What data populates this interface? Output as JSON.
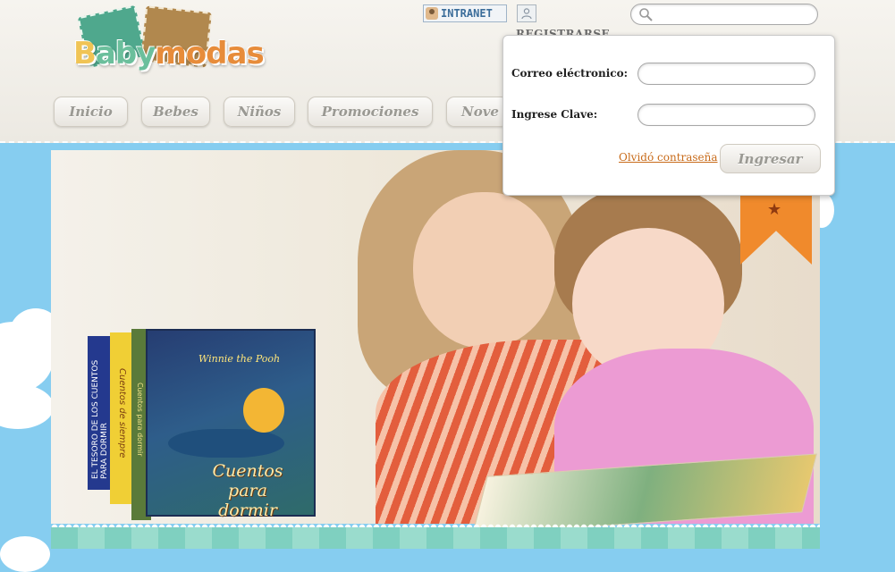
{
  "logo": {
    "text_part1": "B",
    "text_part2": "aby",
    "text_part3": "modas"
  },
  "topbar": {
    "intranet_label": "INTRANET",
    "register_label": "REGISTRARSE",
    "search_placeholder": ""
  },
  "nav": {
    "items": [
      {
        "label": "Inicio"
      },
      {
        "label": "Bebes"
      },
      {
        "label": "Niños"
      },
      {
        "label": "Promociones"
      },
      {
        "label": "Nove"
      }
    ]
  },
  "login": {
    "email_label": "Correo eléctronico:",
    "password_label": "Ingrese Clave:",
    "forgot_label": "Olvidó contraseña",
    "submit_label": "Ingresar",
    "email_value": "",
    "password_value": ""
  },
  "banner": {
    "book_title_line1": "Cuentos",
    "book_title_line2": "para dormir",
    "book_brand": "Winnie the Pooh",
    "spine1": "EL TESORO DE LOS CUENTOS PARA DORMIR",
    "spine2": "Cuentos de siempre",
    "spine3": "Cuentos para dormir"
  },
  "colors": {
    "sky": "#86cdf0",
    "accent_orange": "#f08a2c",
    "link_orange": "#c86b1a"
  }
}
